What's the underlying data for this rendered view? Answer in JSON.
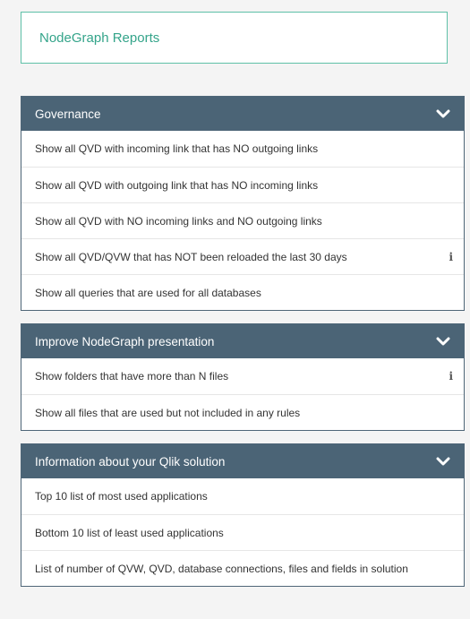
{
  "title": "NodeGraph Reports",
  "colors": {
    "accent": "#34a48a",
    "panel_header": "#4b6476"
  },
  "sections": [
    {
      "header": "Governance",
      "items": [
        {
          "label": "Show all QVD with incoming link that has NO outgoing links",
          "info": false
        },
        {
          "label": "Show all QVD with outgoing link that has NO incoming links",
          "info": false
        },
        {
          "label": "Show all QVD with NO incoming links and NO outgoing links",
          "info": false
        },
        {
          "label": "Show all QVD/QVW that has NOT been reloaded the last 30 days",
          "info": true
        },
        {
          "label": "Show all queries that are used for all databases",
          "info": false
        }
      ]
    },
    {
      "header": "Improve NodeGraph presentation",
      "items": [
        {
          "label": "Show folders that have more than N files",
          "info": true
        },
        {
          "label": "Show all files that are used but not included in any rules",
          "info": false
        }
      ]
    },
    {
      "header": "Information about your Qlik solution",
      "items": [
        {
          "label": "Top 10 list of most used applications",
          "info": false
        },
        {
          "label": "Bottom 10 list of least used applications",
          "info": false
        },
        {
          "label": "List of number of QVW, QVD, database connections, files and fields in solution",
          "info": false
        }
      ]
    }
  ],
  "info_glyph": "i",
  "icons": {
    "collapse": "chevron-down-icon",
    "info": "info-icon"
  }
}
